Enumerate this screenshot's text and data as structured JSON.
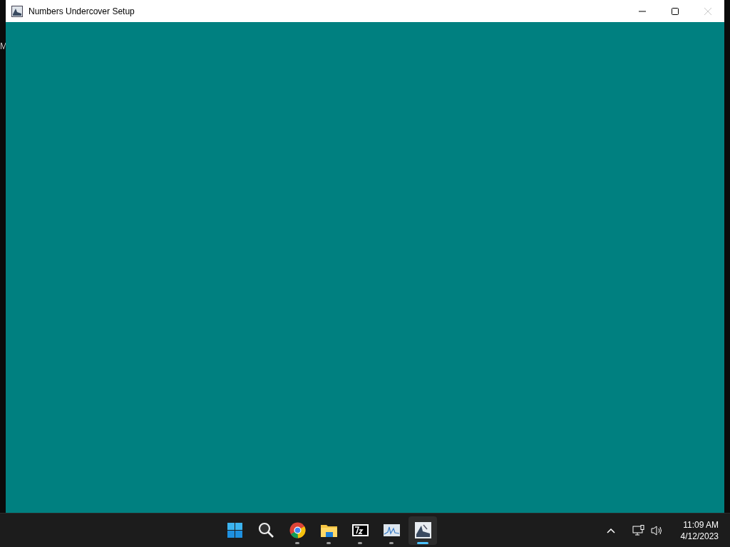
{
  "desktop": {
    "edge_text": "M"
  },
  "window": {
    "title": "Numbers Undercover Setup",
    "close_disabled": true
  },
  "taskbar": {
    "apps": [
      {
        "kind": "start",
        "running": false,
        "active": false
      },
      {
        "kind": "search",
        "running": false,
        "active": false
      },
      {
        "kind": "browser",
        "running": true,
        "active": false
      },
      {
        "kind": "folder",
        "running": true,
        "active": false
      },
      {
        "kind": "archiver",
        "running": true,
        "active": false
      },
      {
        "kind": "monitor",
        "running": true,
        "active": false
      },
      {
        "kind": "setup",
        "running": true,
        "active": true
      }
    ],
    "tray": {
      "time": "11:09 AM",
      "date": "4/12/2023"
    }
  }
}
